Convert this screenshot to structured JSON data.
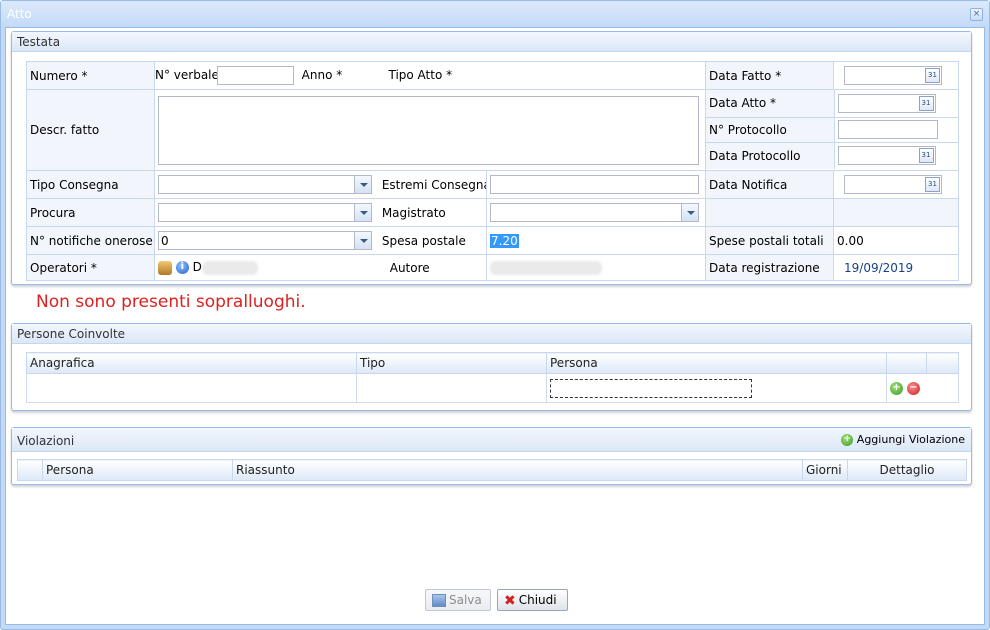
{
  "window": {
    "title": "Atto",
    "close_icon": "×"
  },
  "testata": {
    "title": "Testata",
    "numero_label": "Numero *",
    "verbale_label": "N° verbale",
    "anno_label": "Anno *",
    "tipo_atto_label": "Tipo Atto *",
    "data_fatto_label": "Data Fatto *",
    "descr_label": "Descr. fatto",
    "data_atto_label": "Data Atto *",
    "protocollo_label": "N° Protocollo",
    "data_protocollo_label": "Data Protocollo",
    "tipo_consegna_label": "Tipo Consegna",
    "estremi_label": "Estremi Consegna",
    "data_notifica_label": "Data Notifica",
    "procura_label": "Procura",
    "magistrato_label": "Magistrato",
    "notifiche_label": "N° notifiche onerose",
    "notifiche_value": "0",
    "spesa_label": "Spesa postale",
    "spesa_value": "7.20",
    "spese_totali_label": "Spese postali totali",
    "spese_totali_value": "0.00",
    "operatori_label": "Operatori *",
    "operatori_value": "D",
    "autore_label": "Autore",
    "data_reg_label": "Data registrazione",
    "data_reg_value": "19/09/2019",
    "calendar_glyph": "31"
  },
  "warning": "Non sono presenti sopralluoghi.",
  "persone": {
    "title": "Persone Coinvolte",
    "columns": [
      "Anagrafica",
      "Tipo",
      "Persona"
    ],
    "add_glyph": "+",
    "remove_glyph": "−"
  },
  "violazioni": {
    "title": "Violazioni",
    "add_label": "Aggiungi Violazione",
    "columns": [
      "Persona",
      "Riassunto",
      "Giorni",
      "Dettaglio"
    ]
  },
  "buttons": {
    "salva": "Salva",
    "chiudi": "Chiudi"
  },
  "colors": {
    "accent": "#99bbe8",
    "warning": "#e02020",
    "date_value": "#15428b"
  }
}
